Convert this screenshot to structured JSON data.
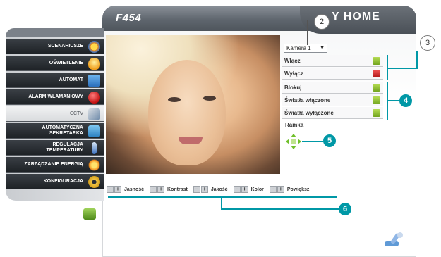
{
  "header": {
    "title": "F454",
    "brand": "Y HOME"
  },
  "sidebar": {
    "items": [
      {
        "label": "SCENARIUSZE",
        "icon": "scenario-icon",
        "active": false
      },
      {
        "label": "OŚWIETLENIE",
        "icon": "lightbulb-icon",
        "active": false
      },
      {
        "label": "AUTOMAT",
        "icon": "automation-icon",
        "active": false
      },
      {
        "label": "ALARM WŁAMANIOWY",
        "icon": "alarm-icon",
        "active": false
      },
      {
        "label": "CCTV",
        "icon": "cctv-camera-icon",
        "active": true
      },
      {
        "label": "AUTOMATYCZNA\nSEKRETARKA",
        "icon": "answering-machine-icon",
        "active": false
      },
      {
        "label": "REGULACJA\nTEMPERATURY",
        "icon": "thermometer-icon",
        "active": false
      },
      {
        "label": "ZARZĄDZANIE ENERGIĄ",
        "icon": "energy-icon",
        "active": false
      },
      {
        "label": "KONFIGURACJA",
        "icon": "gear-icon",
        "active": false
      }
    ]
  },
  "camera": {
    "selected": "Kamera 1"
  },
  "controls": [
    {
      "label": "Włącz",
      "button": "green"
    },
    {
      "label": "Wyłącz",
      "button": "red"
    },
    {
      "label": "Blokuj",
      "button": "green"
    },
    {
      "label": "Światła włączone",
      "button": "green"
    },
    {
      "label": "Światła wyłączone",
      "button": "green"
    }
  ],
  "ramka": {
    "label": "Ramka"
  },
  "bottom": {
    "minus": "−",
    "plus": "+",
    "labels": [
      "Jasność",
      "Kontrast",
      "Jakość",
      "Kolor",
      "Powiększ"
    ]
  },
  "callouts": [
    "2",
    "3",
    "4",
    "5",
    "6"
  ],
  "colors": {
    "accent": "#0098a6",
    "menu_bg": "#1e2226",
    "green_btn": "#73a520",
    "red_btn": "#b01919"
  }
}
